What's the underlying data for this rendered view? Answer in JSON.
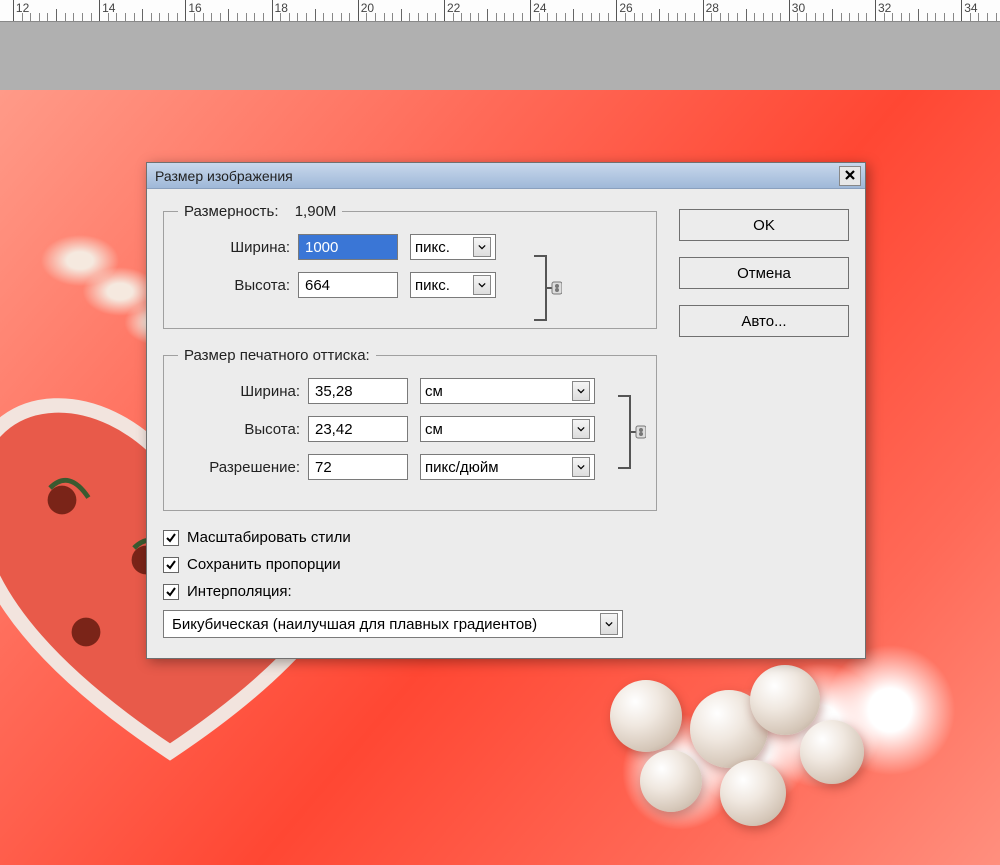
{
  "ruler": {
    "marks": [
      12,
      14,
      16,
      18,
      20,
      22,
      24,
      26,
      28,
      30,
      32,
      34
    ]
  },
  "dialog": {
    "title": "Размер изображения",
    "buttons": {
      "ok": "OK",
      "cancel": "Отмена",
      "auto": "Авто..."
    },
    "pixel_dims": {
      "legend": "Размерность:",
      "size": "1,90M",
      "width_label": "Ширина:",
      "width_value": "1000",
      "height_label": "Высота:",
      "height_value": "664",
      "unit": "пикс."
    },
    "print_dims": {
      "legend": "Размер печатного оттиска:",
      "width_label": "Ширина:",
      "width_value": "35,28",
      "height_label": "Высота:",
      "height_value": "23,42",
      "unit": "см",
      "res_label": "Разрешение:",
      "res_value": "72",
      "res_unit": "пикс/дюйм"
    },
    "checks": {
      "scale_styles": "Масштабировать стили",
      "constrain": "Сохранить пропорции",
      "resample": "Интерполяция:"
    },
    "interp": "Бикубическая (наилучшая для плавных градиентов)"
  }
}
